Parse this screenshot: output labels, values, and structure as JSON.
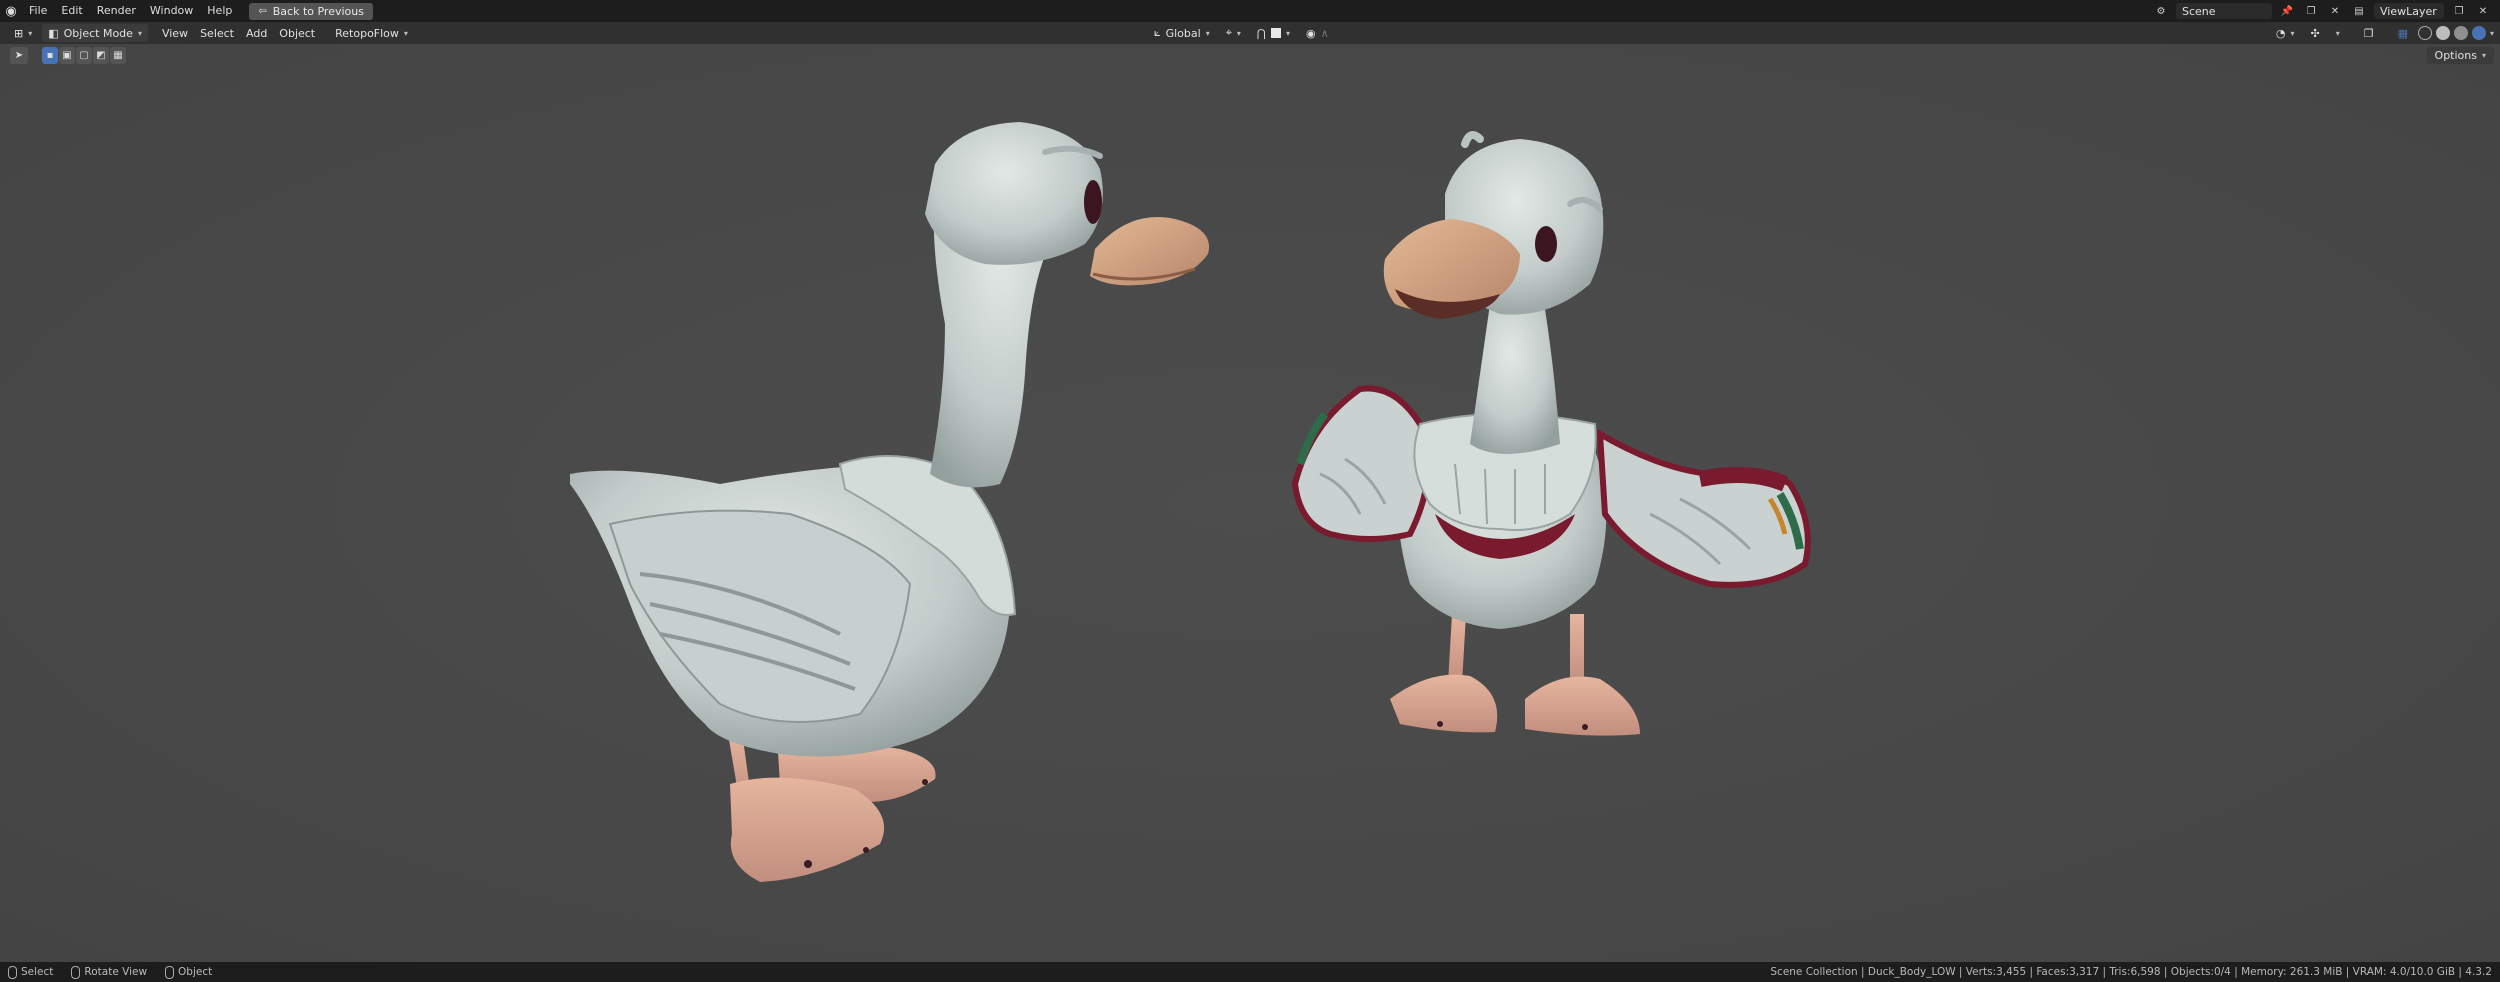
{
  "app": {
    "menus": [
      "File",
      "Edit",
      "Render",
      "Window",
      "Help"
    ],
    "back_button": "Back to Previous"
  },
  "top_right": {
    "scene": "Scene",
    "view_layer": "ViewLayer"
  },
  "header": {
    "mode": "Object Mode",
    "menus": [
      "View",
      "Select",
      "Add",
      "Object",
      "RetopoFlow"
    ],
    "orientation": "Global"
  },
  "toolbar": {
    "options": "Options"
  },
  "status": {
    "select": "Select",
    "rotate": "Rotate View",
    "object": "Object",
    "stats": "Scene Collection | Duck_Body_LOW | Verts:3,455 | Faces:3,317 | Tris:6,598 | Objects:0/4 | Memory: 261.3 MiB | VRAM: 4.0/10.0 GiB | 4.3.2"
  },
  "colors": {
    "accent": "#4772b3",
    "duck_body": "#cfd8d6",
    "duck_beak": "#d9a884",
    "wing_trim": "#7a1a2e"
  }
}
